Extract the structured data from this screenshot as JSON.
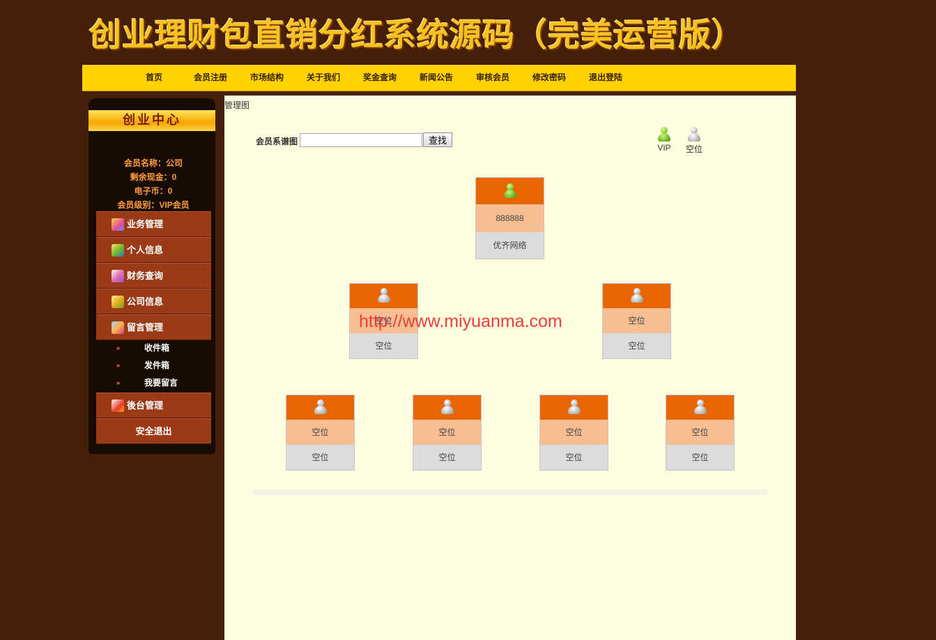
{
  "banner": {
    "title": "创业理财包直销分红系统源码（完美运营版）"
  },
  "nav": {
    "items": [
      {
        "label": "首页"
      },
      {
        "label": "会员注册"
      },
      {
        "label": "市场结构"
      },
      {
        "label": "关于我们"
      },
      {
        "label": "奖金查询"
      },
      {
        "label": "新闻公告"
      },
      {
        "label": "审核会员"
      },
      {
        "label": "修改密码"
      },
      {
        "label": "退出登陆"
      }
    ]
  },
  "sidebar": {
    "title": "创业中心",
    "member_name": "会员名称：公司",
    "cash_balance": "剩余现金：0",
    "e_coins": "电子币：0",
    "member_level": "会员级别：VIP会员",
    "menu": [
      {
        "label": "业务管理",
        "icon": "briefcase-icon"
      },
      {
        "label": "个人信息",
        "icon": "user-info-icon"
      },
      {
        "label": "财务查询",
        "icon": "finance-icon"
      },
      {
        "label": "公司信息",
        "icon": "company-icon"
      },
      {
        "label": "留言管理",
        "icon": "message-icon"
      }
    ],
    "message_sub": [
      {
        "label": "收件箱"
      },
      {
        "label": "发件箱"
      },
      {
        "label": "我要留言"
      }
    ],
    "backend": {
      "label": "後台管理",
      "icon": "home-icon"
    },
    "logout": {
      "label": "安全退出"
    }
  },
  "main": {
    "breadcrumb": "管理图",
    "search_label": "会员系谱图",
    "search_value": "",
    "search_button": "查找",
    "legend": [
      {
        "label": "VIP",
        "icon": "vip-person-icon"
      },
      {
        "label": "空位",
        "icon": "empty-person-icon"
      }
    ],
    "tree": {
      "root": {
        "id": "888888",
        "name": "优齐网络"
      },
      "level2": [
        {
          "id": "空位",
          "name": "空位"
        },
        {
          "id": "空位",
          "name": "空位"
        }
      ],
      "level3": [
        {
          "id": "空位",
          "name": "空位"
        },
        {
          "id": "空位",
          "name": "空位"
        },
        {
          "id": "空位",
          "name": "空位"
        },
        {
          "id": "空位",
          "name": "空位"
        }
      ]
    },
    "watermark": "http://www.miyuanma.com"
  },
  "colors": {
    "page_bg": "#451f07",
    "nav_bg": "#ffd200",
    "sidebar_bg": "#180b03",
    "menu_bg": "#9b3a17",
    "main_bg": "#fffde0",
    "node_top": "#e86500",
    "node_mid": "#f6be92",
    "node_bot": "#dcdcdc"
  }
}
